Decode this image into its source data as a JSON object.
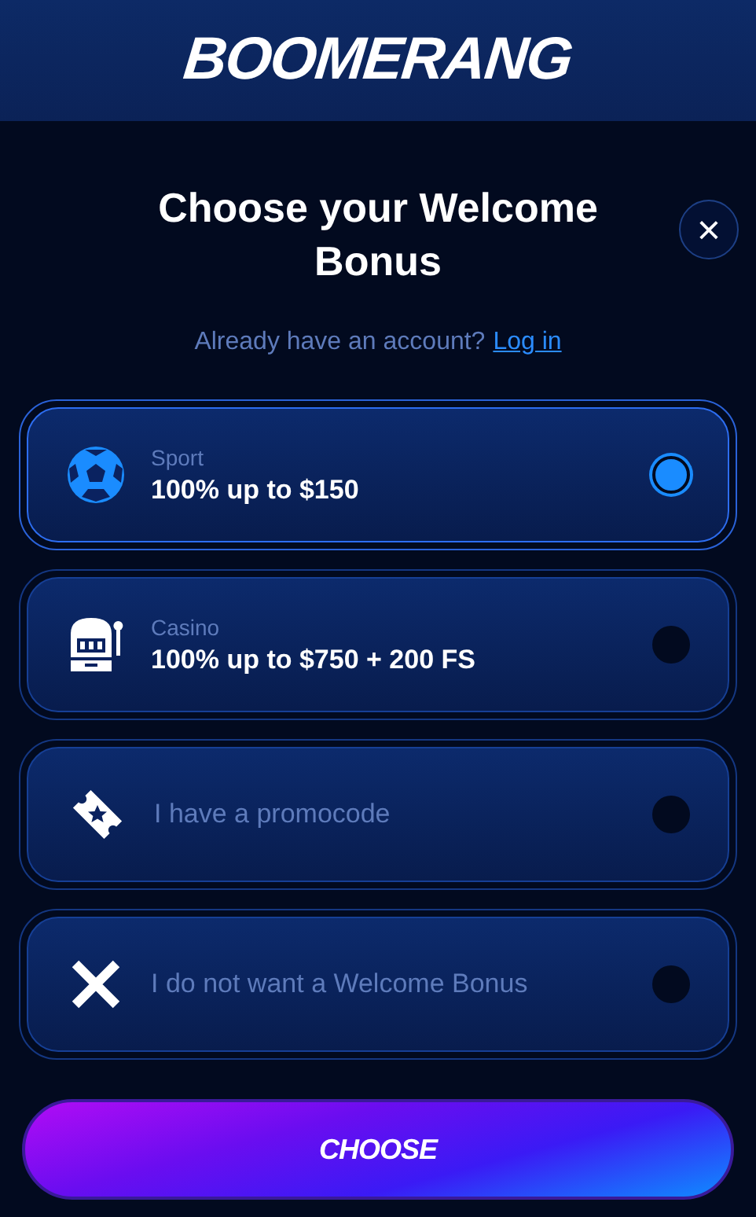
{
  "header": {
    "logo": "BOOMERANG"
  },
  "dialog": {
    "title": "Choose your Welcome Bonus",
    "close": "×",
    "login_prompt": "Already have an account?",
    "login_link": "Log in"
  },
  "options": [
    {
      "kind": "sport",
      "category": "Sport",
      "offer": "100% up to $150",
      "selected": true
    },
    {
      "kind": "casino",
      "category": "Casino",
      "offer": "100% up to $750 + 200 FS",
      "selected": false
    },
    {
      "kind": "promo",
      "label": "I have a promocode",
      "selected": false
    },
    {
      "kind": "decline",
      "label": "I do not want a Welcome Bonus",
      "selected": false
    }
  ],
  "button": "CHOOSE"
}
